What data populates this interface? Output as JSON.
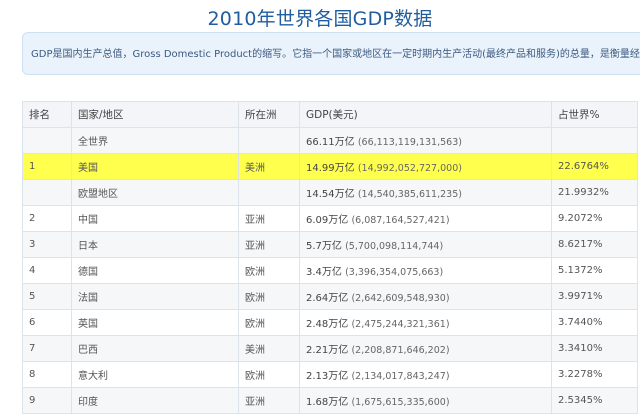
{
  "title": "2010年世界各国GDP数据",
  "description": "GDP是国内生产总值，Gross Domestic Product的缩写。它指一个国家或地区在一定时期内生产活动(最终产品和服务)的总量，是衡量经济规模",
  "columns": [
    "排名",
    "国家/地区",
    "所在洲",
    "GDP(美元)",
    "占世界%"
  ],
  "rows": [
    {
      "rank": "",
      "country": "全世界",
      "continent": "",
      "gdp_short": "66.11万亿",
      "gdp_full": "(66,113,119,131,563)",
      "share": "",
      "highlight": false
    },
    {
      "rank": "1",
      "country": "美国",
      "continent": "美洲",
      "gdp_short": "14.99万亿",
      "gdp_full": "(14,992,052,727,000)",
      "share": "22.6764%",
      "highlight": true
    },
    {
      "rank": "",
      "country": "欧盟地区",
      "continent": "",
      "gdp_short": "14.54万亿",
      "gdp_full": "(14,540,385,611,235)",
      "share": "21.9932%",
      "highlight": false
    },
    {
      "rank": "2",
      "country": "中国",
      "continent": "亚洲",
      "gdp_short": "6.09万亿",
      "gdp_full": "(6,087,164,527,421)",
      "share": "9.2072%",
      "highlight": false
    },
    {
      "rank": "3",
      "country": "日本",
      "continent": "亚洲",
      "gdp_short": "5.7万亿",
      "gdp_full": "(5,700,098,114,744)",
      "share": "8.6217%",
      "highlight": false
    },
    {
      "rank": "4",
      "country": "德国",
      "continent": "欧洲",
      "gdp_short": "3.4万亿",
      "gdp_full": "(3,396,354,075,663)",
      "share": "5.1372%",
      "highlight": false
    },
    {
      "rank": "5",
      "country": "法国",
      "continent": "欧洲",
      "gdp_short": "2.64万亿",
      "gdp_full": "(2,642,609,548,930)",
      "share": "3.9971%",
      "highlight": false
    },
    {
      "rank": "6",
      "country": "英国",
      "continent": "欧洲",
      "gdp_short": "2.48万亿",
      "gdp_full": "(2,475,244,321,361)",
      "share": "3.7440%",
      "highlight": false
    },
    {
      "rank": "7",
      "country": "巴西",
      "continent": "美洲",
      "gdp_short": "2.21万亿",
      "gdp_full": "(2,208,871,646,202)",
      "share": "3.3410%",
      "highlight": false
    },
    {
      "rank": "8",
      "country": "意大利",
      "continent": "欧洲",
      "gdp_short": "2.13万亿",
      "gdp_full": "(2,134,017,843,247)",
      "share": "3.2278%",
      "highlight": false
    },
    {
      "rank": "9",
      "country": "印度",
      "continent": "亚洲",
      "gdp_short": "1.68万亿",
      "gdp_full": "(1,675,615,335,600)",
      "share": "2.5345%",
      "highlight": false
    }
  ],
  "colors": {
    "highlight": "#ffff4d",
    "title": "#1f5d9e",
    "description_bg": "#eaf2fb"
  }
}
